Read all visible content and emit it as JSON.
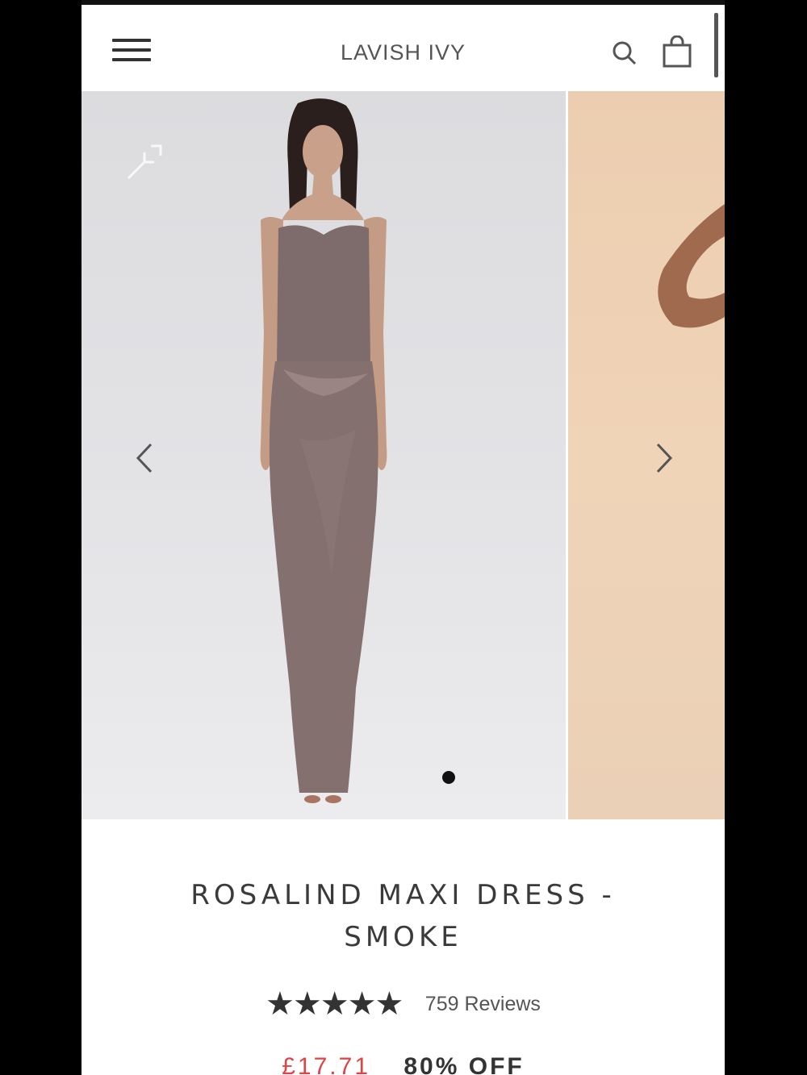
{
  "header": {
    "brand": "LAVISH IVY",
    "menu_icon": "hamburger-menu-icon",
    "search_icon": "search-icon",
    "cart_icon": "shopping-bag-icon"
  },
  "gallery": {
    "images": [
      {
        "alt": "Rosalind Maxi Dress - Smoke front view"
      },
      {
        "alt": "Rosalind Maxi Dress alternate view"
      }
    ],
    "prev_icon": "chevron-left-icon",
    "next_icon": "chevron-right-icon",
    "active_index": 0
  },
  "product": {
    "title_line1": "ROSALIND MAXI DRESS -",
    "title_line2": "SMOKE",
    "rating": 4.7,
    "stars": "★★★★★",
    "reviews_text": "759 Reviews",
    "sale_price": "£17.71",
    "discount": "80% OFF"
  },
  "colors": {
    "dress": "#7e6b6b",
    "sale_price": "#dd4444"
  }
}
